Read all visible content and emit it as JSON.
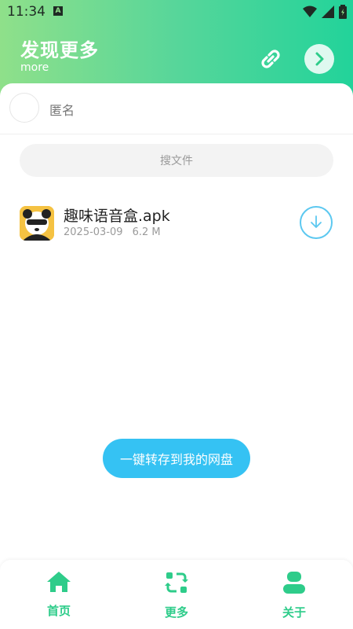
{
  "status_bar": {
    "time": "11:34",
    "app_badge": "A"
  },
  "header": {
    "title": "发现更多",
    "subtitle": "more",
    "link_icon": "link-icon",
    "next_icon": "chevron-right-icon"
  },
  "user": {
    "name": "匿名"
  },
  "search": {
    "placeholder": "搜文件"
  },
  "files": [
    {
      "name": "趣味语音盒.apk",
      "date": "2025-03-09",
      "size": "6.2 M"
    }
  ],
  "actions": {
    "save_to_drive": "一键转存到我的网盘"
  },
  "bottom_nav": [
    {
      "label": "首页",
      "icon": "home-icon"
    },
    {
      "label": "更多",
      "icon": "refresh-icon"
    },
    {
      "label": "关于",
      "icon": "person-icon"
    }
  ],
  "colors": {
    "accent": "#2ecc8a",
    "header_start": "#8fe08a",
    "header_end": "#22d39a",
    "button_blue": "#35c2f3"
  }
}
